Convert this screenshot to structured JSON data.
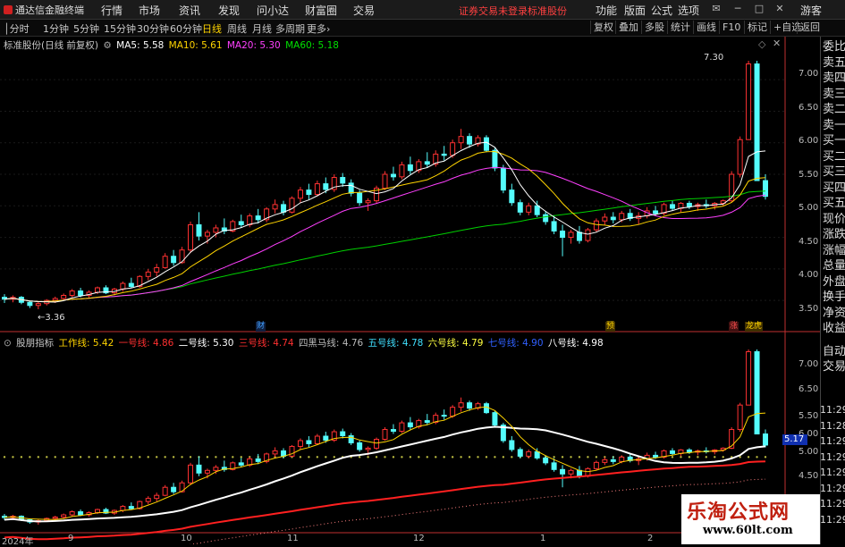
{
  "titlebar": {
    "app_name": "通达信金融终端",
    "menus": [
      "行情",
      "市场",
      "资讯",
      "发现",
      "问小达",
      "财富圈",
      "交易"
    ],
    "notice": "证券交易未登录",
    "stock_name": "标准股份",
    "right_menus": [
      "功能",
      "版面",
      "公式",
      "选项"
    ],
    "guest": "游客"
  },
  "toolbar": {
    "timeframes": [
      "分时",
      "1分钟",
      "5分钟",
      "15分钟",
      "30分钟",
      "60分钟",
      "日线",
      "周线",
      "月线",
      "多周期",
      "更多"
    ],
    "active": "日线",
    "right_buttons": [
      "复权",
      "叠加",
      "多股",
      "统计",
      "画线",
      "F10",
      "标记",
      "+自选",
      "返回"
    ]
  },
  "main_chart": {
    "title": "标准股份(日线 前复权)",
    "ma": [
      {
        "label": "MA5: 5.58",
        "color": "#ffffff"
      },
      {
        "label": "MA10: 5.61",
        "color": "#ffd400"
      },
      {
        "label": "MA20: 5.30",
        "color": "#ff40ff"
      },
      {
        "label": "MA60: 5.18",
        "color": "#00e000"
      }
    ],
    "high_label": "7.30",
    "low_label": "3.36",
    "axis": [
      "7.00",
      "6.50",
      "6.00",
      "5.50",
      "5.00",
      "4.50",
      "4.00",
      "3.50"
    ],
    "markers": {
      "cai": "财",
      "yu": "预",
      "zhang": "涨",
      "long": "龙虎"
    }
  },
  "sub_chart": {
    "title": "股朋指标",
    "lines": [
      {
        "label": "工作线: 5.42",
        "color": "#ffd400"
      },
      {
        "label": "一号线: 4.86",
        "color": "#ff3030"
      },
      {
        "label": "二号线: 5.30",
        "color": "#ffffff"
      },
      {
        "label": "三号线: 4.74",
        "color": "#ff3030"
      },
      {
        "label": "四黑马线: 4.76",
        "color": "#bbbbbb"
      },
      {
        "label": "五号线: 4.78",
        "color": "#40e0ff"
      },
      {
        "label": "六号线: 4.79",
        "color": "#ffff40"
      },
      {
        "label": "七号线: 4.90",
        "color": "#3060ff"
      },
      {
        "label": "八号线: 4.98",
        "color": "#ffffff"
      }
    ],
    "axis": [
      "7.00",
      "6.50",
      "6.00",
      "5.50",
      "5.00",
      "4.50"
    ],
    "current_label": "5.17",
    "right_labels": [
      "11:29",
      "11:28",
      "11:29",
      "11:29",
      "11:29",
      "11:29",
      "11:29",
      "11:29"
    ]
  },
  "dates": [
    "2024年",
    "9",
    "10",
    "11",
    "12",
    "1",
    "2"
  ],
  "right_panel": {
    "top": [
      "委比",
      "卖五",
      "卖四",
      "卖三",
      "卖二",
      "卖一",
      "买一",
      "买二",
      "买三",
      "买四",
      "买五",
      "现价",
      "涨跌",
      "涨幅",
      "总量",
      "外盘",
      "换手",
      "净资",
      "收益"
    ],
    "bottom": [
      "自动",
      "交易"
    ]
  },
  "watermark": {
    "line1": "乐淘公式网",
    "line2": "www.60lt.com"
  },
  "chart_data": {
    "type": "candlestick",
    "ylim": [
      3.36,
      7.3
    ],
    "ohlc": [
      [
        3.55,
        3.6,
        3.46,
        3.52
      ],
      [
        3.52,
        3.58,
        3.47,
        3.55
      ],
      [
        3.55,
        3.57,
        3.44,
        3.47
      ],
      [
        3.47,
        3.5,
        3.38,
        3.42
      ],
      [
        3.42,
        3.48,
        3.36,
        3.45
      ],
      [
        3.45,
        3.52,
        3.42,
        3.5
      ],
      [
        3.5,
        3.56,
        3.46,
        3.53
      ],
      [
        3.53,
        3.61,
        3.5,
        3.58
      ],
      [
        3.58,
        3.68,
        3.55,
        3.65
      ],
      [
        3.65,
        3.7,
        3.55,
        3.58
      ],
      [
        3.58,
        3.66,
        3.54,
        3.63
      ],
      [
        3.63,
        3.72,
        3.6,
        3.7
      ],
      [
        3.7,
        3.74,
        3.6,
        3.62
      ],
      [
        3.62,
        3.7,
        3.58,
        3.68
      ],
      [
        3.68,
        3.8,
        3.64,
        3.77
      ],
      [
        3.77,
        3.86,
        3.7,
        3.72
      ],
      [
        3.72,
        3.9,
        3.7,
        3.88
      ],
      [
        3.88,
        4.0,
        3.82,
        3.95
      ],
      [
        3.95,
        4.08,
        3.88,
        4.02
      ],
      [
        4.02,
        4.25,
        4.0,
        4.2
      ],
      [
        4.2,
        4.3,
        4.05,
        4.1
      ],
      [
        4.1,
        4.35,
        4.08,
        4.3
      ],
      [
        4.3,
        4.75,
        4.25,
        4.7
      ],
      [
        4.7,
        4.9,
        4.45,
        4.52
      ],
      [
        4.52,
        4.62,
        4.4,
        4.58
      ],
      [
        4.58,
        4.7,
        4.5,
        4.65
      ],
      [
        4.65,
        4.8,
        4.55,
        4.6
      ],
      [
        4.6,
        4.78,
        4.58,
        4.75
      ],
      [
        4.75,
        4.86,
        4.65,
        4.7
      ],
      [
        4.7,
        4.88,
        4.66,
        4.84
      ],
      [
        4.84,
        4.95,
        4.72,
        4.78
      ],
      [
        4.78,
        4.98,
        4.74,
        4.95
      ],
      [
        4.95,
        5.1,
        4.88,
        5.02
      ],
      [
        5.02,
        5.08,
        4.85,
        4.9
      ],
      [
        4.9,
        5.15,
        4.88,
        5.12
      ],
      [
        5.12,
        5.3,
        5.05,
        5.25
      ],
      [
        5.25,
        5.35,
        5.1,
        5.18
      ],
      [
        5.18,
        5.4,
        5.15,
        5.35
      ],
      [
        5.35,
        5.45,
        5.2,
        5.26
      ],
      [
        5.26,
        5.5,
        5.22,
        5.45
      ],
      [
        5.45,
        5.52,
        5.3,
        5.36
      ],
      [
        5.36,
        5.42,
        5.15,
        5.2
      ],
      [
        5.2,
        5.25,
        5.0,
        5.05
      ],
      [
        5.05,
        5.12,
        4.92,
        5.08
      ],
      [
        5.08,
        5.32,
        5.04,
        5.28
      ],
      [
        5.28,
        5.55,
        5.25,
        5.5
      ],
      [
        5.5,
        5.62,
        5.4,
        5.46
      ],
      [
        5.46,
        5.7,
        5.42,
        5.65
      ],
      [
        5.65,
        5.78,
        5.5,
        5.56
      ],
      [
        5.56,
        5.74,
        5.52,
        5.7
      ],
      [
        5.7,
        5.85,
        5.6,
        5.66
      ],
      [
        5.66,
        5.88,
        5.62,
        5.82
      ],
      [
        5.82,
        5.95,
        5.72,
        5.8
      ],
      [
        5.8,
        6.05,
        5.76,
        6.0
      ],
      [
        6.0,
        6.22,
        5.9,
        6.1
      ],
      [
        6.1,
        6.15,
        5.92,
        5.98
      ],
      [
        5.98,
        6.12,
        5.94,
        6.08
      ],
      [
        6.08,
        6.12,
        5.85,
        5.88
      ],
      [
        5.88,
        5.92,
        5.55,
        5.6
      ],
      [
        5.6,
        5.65,
        5.2,
        5.25
      ],
      [
        5.25,
        5.35,
        5.0,
        5.05
      ],
      [
        5.05,
        5.1,
        4.85,
        4.9
      ],
      [
        4.9,
        5.05,
        4.85,
        5.0
      ],
      [
        5.0,
        5.08,
        4.82,
        4.86
      ],
      [
        4.86,
        4.92,
        4.7,
        4.75
      ],
      [
        4.75,
        4.85,
        4.55,
        4.6
      ],
      [
        4.6,
        4.7,
        4.2,
        4.5
      ],
      [
        4.5,
        4.62,
        4.4,
        4.58
      ],
      [
        4.58,
        4.68,
        4.4,
        4.45
      ],
      [
        4.45,
        4.65,
        4.42,
        4.62
      ],
      [
        4.62,
        4.8,
        4.58,
        4.76
      ],
      [
        4.76,
        4.88,
        4.7,
        4.82
      ],
      [
        4.82,
        4.9,
        4.72,
        4.78
      ],
      [
        4.78,
        4.92,
        4.74,
        4.88
      ],
      [
        4.88,
        4.95,
        4.76,
        4.8
      ],
      [
        4.8,
        4.9,
        4.7,
        4.84
      ],
      [
        4.84,
        4.98,
        4.8,
        4.92
      ],
      [
        4.92,
        5.0,
        4.84,
        4.88
      ],
      [
        4.88,
        5.05,
        4.85,
        5.02
      ],
      [
        5.02,
        5.08,
        4.92,
        4.96
      ],
      [
        4.96,
        5.06,
        4.9,
        5.04
      ],
      [
        5.04,
        5.08,
        4.95,
        4.99
      ],
      [
        4.99,
        5.05,
        4.92,
        5.02
      ],
      [
        5.02,
        5.1,
        4.96,
        5.0
      ],
      [
        5.0,
        5.06,
        4.94,
        5.04
      ],
      [
        5.04,
        5.1,
        5.0,
        5.08
      ],
      [
        5.08,
        5.55,
        5.06,
        5.5
      ],
      [
        5.5,
        6.1,
        5.45,
        6.05
      ],
      [
        6.05,
        7.3,
        6.3,
        7.25
      ],
      [
        7.25,
        7.3,
        6.1,
        5.4
      ],
      [
        5.4,
        5.5,
        5.1,
        5.15
      ]
    ],
    "ma": {
      "MA5": 5.58,
      "MA10": 5.61,
      "MA20": 5.3,
      "MA60": 5.18
    }
  }
}
